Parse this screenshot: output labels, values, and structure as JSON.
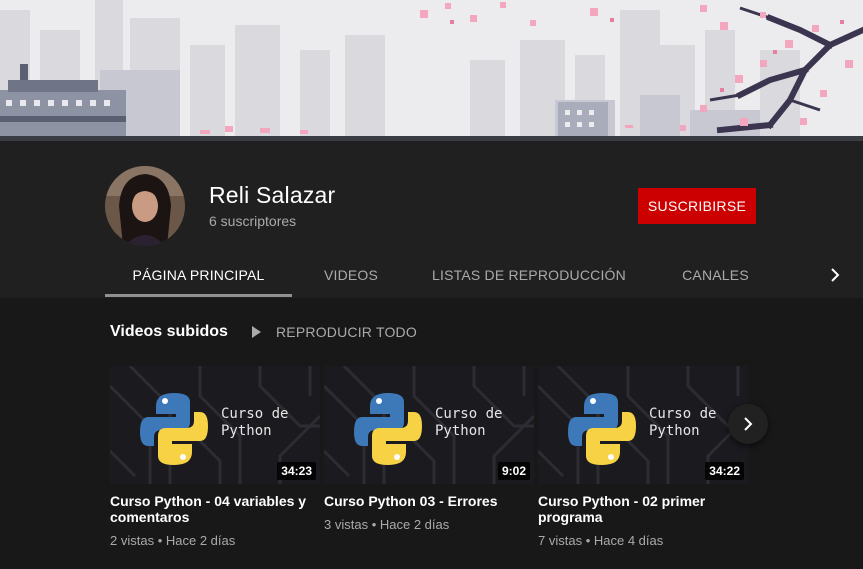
{
  "channel": {
    "name": "Reli Salazar",
    "subscribers": "6 suscriptores",
    "subscribe_label": "SUSCRIBIRSE"
  },
  "tabs": [
    {
      "label": "PÁGINA PRINCIPAL",
      "active": true
    },
    {
      "label": "VIDEOS",
      "active": false
    },
    {
      "label": "LISTAS DE REPRODUCCIÓN",
      "active": false
    },
    {
      "label": "CANALES",
      "active": false
    }
  ],
  "shelf": {
    "title": "Videos subidos",
    "play_all_label": "REPRODUCIR TODO"
  },
  "videos": [
    {
      "thumb_text": "Curso de\nPython",
      "duration": "34:23",
      "title": "Curso Python - 04 variables y comentaros",
      "views": "2 vistas",
      "age": "Hace 2 días"
    },
    {
      "thumb_text": "Curso de\nPython",
      "duration": "9:02",
      "title": "Curso Python 03 - Errores",
      "views": "3 vistas",
      "age": "Hace 2 días"
    },
    {
      "thumb_text": "Curso de\nPython",
      "duration": "34:22",
      "title": "Curso Python - 02 primer programa",
      "views": "7 vistas",
      "age": "Hace 4 días"
    }
  ],
  "icons": {
    "tabs_next": "chevron-right-icon",
    "play_all": "play-icon",
    "shelf_next": "chevron-right-icon",
    "thumbnail_logo": "python-logo-icon"
  },
  "colors": {
    "subscribe": "#cc0000",
    "header_bg": "#202020",
    "page_bg": "#181818",
    "banner_bg": "#ecebee",
    "blossom": "#f2a7be"
  }
}
